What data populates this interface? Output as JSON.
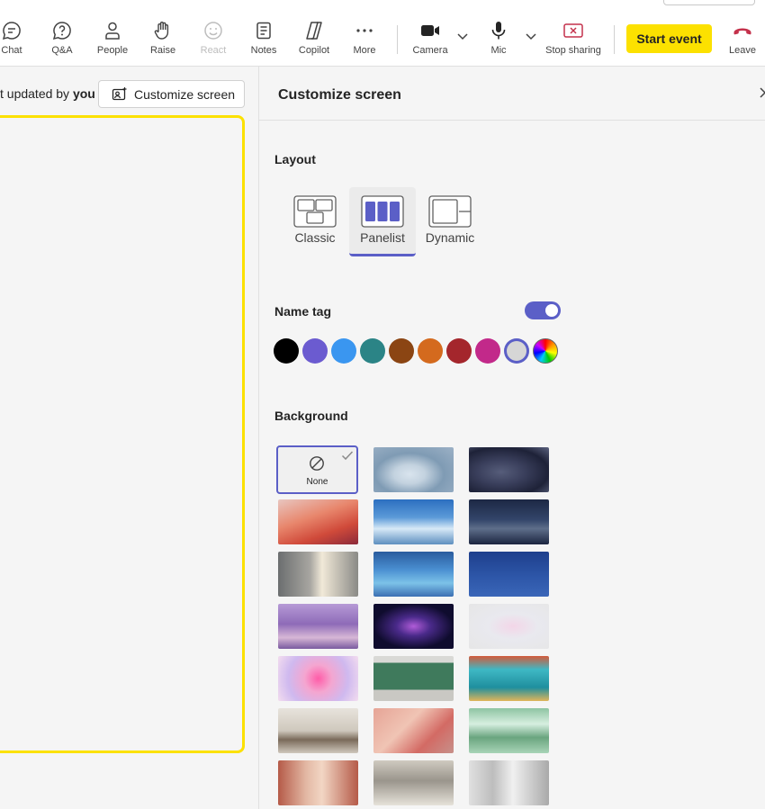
{
  "toolbar": {
    "items": [
      {
        "label": "Chat",
        "icon": "chat-icon"
      },
      {
        "label": "Q&A",
        "icon": "qna-icon"
      },
      {
        "label": "People",
        "icon": "people-icon"
      },
      {
        "label": "Raise",
        "icon": "raise-hand-icon"
      },
      {
        "label": "React",
        "icon": "react-icon",
        "disabled": true
      },
      {
        "label": "Notes",
        "icon": "notes-icon"
      },
      {
        "label": "Copilot",
        "icon": "copilot-icon"
      },
      {
        "label": "More",
        "icon": "more-icon"
      },
      {
        "label": "Camera",
        "icon": "camera-icon"
      },
      {
        "label": "Mic",
        "icon": "mic-icon"
      },
      {
        "label": "Stop sharing",
        "icon": "stop-sharing-icon"
      }
    ],
    "start_event_label": "Start event",
    "leave_label": "Leave",
    "colors": {
      "start_event": "#fce100",
      "leave": "#c4314b",
      "stop_sharing": "#c4314b"
    }
  },
  "stage": {
    "updated_prefix": "t updated by ",
    "updated_by": "you",
    "customize_button_label": "Customize screen",
    "border_color": "#fce100"
  },
  "panel": {
    "title": "Customize screen",
    "layout": {
      "title": "Layout",
      "options": [
        {
          "label": "Classic",
          "selected": false
        },
        {
          "label": "Panelist",
          "selected": true
        },
        {
          "label": "Dynamic",
          "selected": false
        }
      ]
    },
    "name_tag": {
      "title": "Name tag",
      "enabled": true,
      "colors": [
        "#000000",
        "#6b5bd0",
        "#3a96f0",
        "#2b8486",
        "#8b4513",
        "#d46a1e",
        "#a4262c",
        "#c2298a",
        "#d6d6d6",
        "rainbow"
      ],
      "selected_index": 8
    },
    "background": {
      "title": "Background",
      "none_label": "None",
      "selected": "None",
      "tile_count": 21
    }
  }
}
